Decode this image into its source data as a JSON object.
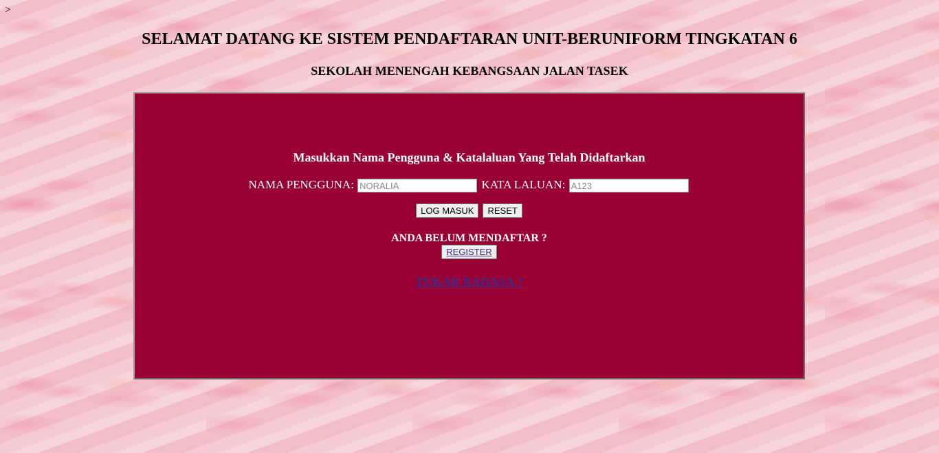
{
  "page": {
    "stray_text": ">",
    "title": "SELAMAT DATANG KE SISTEM PENDAFTARAN UNIT-BERUNIFORM TINGKATAN 6",
    "subtitle": "SEKOLAH MENENGAH KEBANGSAAN JALAN TASEK"
  },
  "login": {
    "instruction": "Masukkan Nama Pengguna & Katalaluan Yang Telah Didaftarkan",
    "username_label": "NAMA PENGGUNA:",
    "username_placeholder": "NORALIA",
    "password_label": "KATA LALUAN:",
    "password_placeholder": "A123",
    "login_button": "LOG MASUK",
    "reset_button": "RESET",
    "not_registered_text": "ANDA BELUM MENDAFTAR ?",
    "register_button": "REGISTER",
    "change_language_link": "TUKAR BAHASA ?"
  },
  "colors": {
    "panel_background": "#990033",
    "link": "#3b2a8a"
  }
}
